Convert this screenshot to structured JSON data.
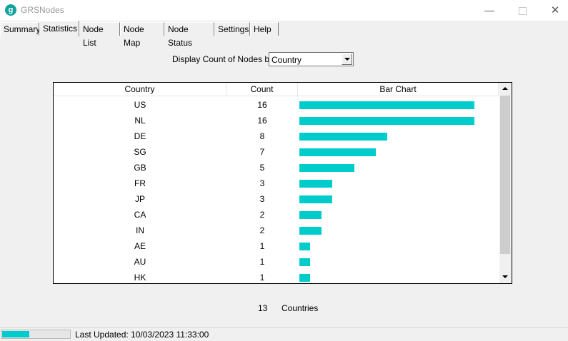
{
  "window": {
    "title": "GRSNodes",
    "icon_name": "app-logo-icon"
  },
  "tabs": [
    {
      "label": "Summary",
      "active": false
    },
    {
      "label": "Statistics",
      "active": true
    },
    {
      "label": "Node List",
      "active": false
    },
    {
      "label": "Node Map",
      "active": false
    },
    {
      "label": "Node Status",
      "active": false
    },
    {
      "label": "Settings",
      "active": false
    },
    {
      "label": "Help",
      "active": false
    }
  ],
  "display": {
    "label": "Display Count of Nodes by",
    "selected": "Country"
  },
  "table": {
    "headers": {
      "country": "Country",
      "count": "Count",
      "bar": "Bar Chart"
    },
    "max_count": 16,
    "rows": [
      {
        "country": "US",
        "count": "16"
      },
      {
        "country": "NL",
        "count": "16"
      },
      {
        "country": "DE",
        "count": "8"
      },
      {
        "country": "SG",
        "count": "7"
      },
      {
        "country": "GB",
        "count": "5"
      },
      {
        "country": "FR",
        "count": "3"
      },
      {
        "country": "JP",
        "count": "3"
      },
      {
        "country": "CA",
        "count": "2"
      },
      {
        "country": "IN",
        "count": "2"
      },
      {
        "country": "AE",
        "count": "1"
      },
      {
        "country": "AU",
        "count": "1"
      },
      {
        "country": "HK",
        "count": "1"
      }
    ]
  },
  "summary": {
    "count": "13",
    "label": "Countries"
  },
  "status": {
    "progress": 0.4,
    "text": "Last Updated: 10/03/2023 11:33:00"
  },
  "colors": {
    "bar": "#00cccc",
    "accent": "#10a39c"
  }
}
